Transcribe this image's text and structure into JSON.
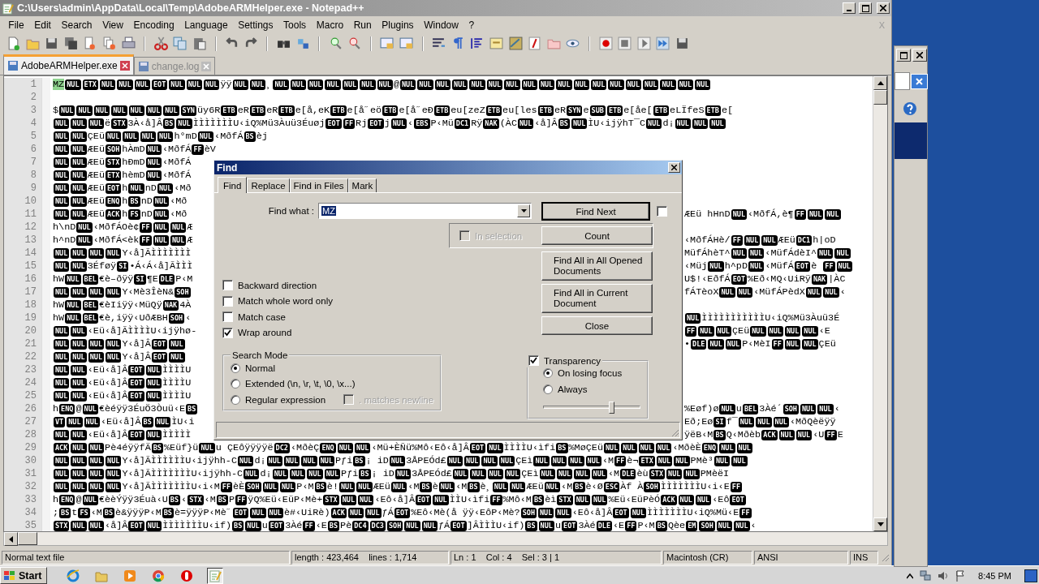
{
  "window": {
    "title": "C:\\Users\\admin\\AppData\\Local\\Temp\\AdobeARMHelper.exe - Notepad++"
  },
  "menu": [
    "File",
    "Edit",
    "Search",
    "View",
    "Encoding",
    "Language",
    "Settings",
    "Tools",
    "Macro",
    "Run",
    "Plugins",
    "Window",
    "?"
  ],
  "close_doc": "X",
  "tabs": [
    {
      "label": "AdobeARMHelper.exe",
      "selected": true
    },
    {
      "label": "change.log",
      "selected": false
    }
  ],
  "editor": {
    "lines": [
      {
        "n": "1",
        "parts": [
          {
            "text": "MZ",
            "selected": true
          },
          {
            "c": "NUL"
          },
          {
            "c": "ETX"
          },
          {
            "c": "NUL"
          },
          {
            "c": "NUL"
          },
          {
            "c": "NUL"
          },
          {
            "c": "EOT"
          },
          {
            "c": "NUL"
          },
          {
            "c": "NUL"
          },
          {
            "c": "NUL"
          },
          "ÿÿ",
          {
            "c": "NUL"
          },
          {
            "c": "NUL"
          },
          "¸",
          {
            "c": "NUL"
          },
          {
            "c": "NUL"
          },
          {
            "c": "NUL"
          },
          {
            "c": "NUL"
          },
          {
            "c": "NUL"
          },
          {
            "c": "NUL"
          },
          {
            "c": "NUL"
          },
          "@",
          {
            "c": "NUL"
          },
          {
            "c": "NUL"
          },
          {
            "c": "NUL"
          },
          {
            "c": "NUL"
          },
          {
            "c": "NUL"
          },
          {
            "c": "NUL"
          },
          {
            "c": "NUL"
          },
          {
            "c": "NUL"
          },
          {
            "c": "NUL"
          },
          {
            "c": "NUL"
          },
          {
            "c": "NUL"
          },
          {
            "c": "NUL"
          },
          {
            "c": "NUL"
          },
          {
            "c": "NUL"
          },
          {
            "c": "NUL"
          },
          {
            "c": "NUL"
          },
          {
            "c": "NUL"
          },
          {
            "c": "NUL"
          }
        ]
      },
      {
        "n": "2"
      },
      {
        "n": "3",
        "parts": [
          "$",
          {
            "c": "NUL"
          },
          {
            "c": "NUL"
          },
          {
            "c": "NUL"
          },
          {
            "c": "NUL"
          },
          {
            "c": "NUL"
          },
          {
            "c": "NUL"
          },
          {
            "c": "NUL"
          },
          {
            "c": "SYN"
          },
          "üy6R",
          {
            "c": "ETB"
          },
          "eR",
          {
            "c": "ETB"
          },
          "eR",
          {
            "c": "ETB"
          },
          "e[å,eK",
          {
            "c": "ETB"
          },
          "e[å˝eö",
          {
            "c": "ETB"
          },
          "e[å˝eĐ",
          {
            "c": "ETB"
          },
          "eu[zeZ",
          {
            "c": "ETB"
          },
          "eu[les",
          {
            "c": "ETB"
          },
          "eR",
          {
            "c": "SYN"
          },
          "e",
          {
            "c": "SUB"
          },
          {
            "c": "ETB"
          },
          "e[åe[",
          {
            "c": "ETB"
          },
          "eLÏfeS",
          {
            "c": "ETB"
          },
          "e["
        ]
      },
      {
        "n": "4",
        "parts": [
          {
            "c": "NUL"
          },
          {
            "c": "NUL"
          },
          {
            "c": "NUL"
          },
          "ë",
          {
            "c": "STX"
          },
          "3À‹å]Â",
          {
            "c": "BS"
          },
          {
            "c": "NUL"
          },
          "ÌÌÌÌÌÌÌU‹iQ%Mü3Àuü3Éuøj",
          {
            "c": "EOT"
          },
          {
            "c": "FF"
          },
          "Rj",
          {
            "c": "EOT"
          },
          "j",
          {
            "c": "NUL"
          },
          "‹",
          {
            "c": "EBS"
          },
          "P‹Mü",
          {
            "c": "DC1"
          },
          "Rÿ",
          {
            "c": "NAK"
          },
          "(ÀC",
          {
            "c": "NUL"
          },
          "‹å]Â",
          {
            "c": "BS"
          },
          {
            "c": "NUL"
          },
          "ÌU‹ijÿhT¯C",
          {
            "c": "NUL"
          },
          "d¡",
          {
            "c": "NUL"
          },
          {
            "c": "NUL"
          },
          {
            "c": "NUL"
          }
        ]
      },
      {
        "n": "5",
        "parts": [
          {
            "c": "NUL"
          },
          {
            "c": "NUL"
          },
          "ÇEü",
          {
            "c": "NUL"
          },
          {
            "c": "NUL"
          },
          {
            "c": "NUL"
          },
          {
            "c": "NUL"
          },
          "h°mD",
          {
            "c": "NUL"
          },
          "‹MðfÁ",
          {
            "c": "BS"
          },
          "èj"
        ]
      },
      {
        "n": "6",
        "parts": [
          {
            "c": "NUL"
          },
          {
            "c": "NUL"
          },
          "ÆEü",
          {
            "c": "SOH"
          },
          "hÀmD",
          {
            "c": "NUL"
          },
          "‹MðfÁ",
          {
            "c": "FF"
          },
          "èV"
        ]
      },
      {
        "n": "7",
        "parts": [
          {
            "c": "NUL"
          },
          {
            "c": "NUL"
          },
          "ÆEü",
          {
            "c": "STX"
          },
          "hÐmD",
          {
            "c": "NUL"
          },
          "‹MðfÁ"
        ]
      },
      {
        "n": "8",
        "parts": [
          {
            "c": "NUL"
          },
          {
            "c": "NUL"
          },
          "ÆEü",
          {
            "c": "ETX"
          },
          "hèmD",
          {
            "c": "NUL"
          },
          "‹MðfÁ"
        ]
      },
      {
        "n": "9",
        "parts": [
          {
            "c": "NUL"
          },
          {
            "c": "NUL"
          },
          "ÆEü",
          {
            "c": "EOT"
          },
          "h",
          {
            "c": "NUL"
          },
          "nD",
          {
            "c": "NUL"
          },
          "‹Mð"
        ]
      },
      {
        "n": "10",
        "parts": [
          {
            "c": "NUL"
          },
          {
            "c": "NUL"
          },
          "ÆEü",
          {
            "c": "ENQ"
          },
          "h",
          {
            "c": "BS"
          },
          "nD",
          {
            "c": "NUL"
          },
          "‹Mð"
        ]
      },
      {
        "n": "11",
        "parts": [
          {
            "c": "NUL"
          },
          {
            "c": "NUL"
          },
          "ÆEü",
          {
            "c": "ACK"
          },
          "h",
          {
            "c": "FS"
          },
          "nD",
          {
            "c": "NUL"
          },
          "‹Mð"
        ],
        "tail": [
          "ÆEü hHnD",
          {
            "c": "NUL"
          },
          "‹MðfÁ,è¶",
          {
            "c": "FF"
          },
          {
            "c": "NUL"
          },
          {
            "c": "NUL"
          }
        ]
      },
      {
        "n": "12",
        "parts": [
          "h\\nD",
          {
            "c": "NUL"
          },
          "‹MðfÁOè¢",
          {
            "c": "FF"
          },
          {
            "c": "NUL"
          },
          {
            "c": "NUL"
          },
          "Æ"
        ]
      },
      {
        "n": "13",
        "parts": [
          "h^nD",
          {
            "c": "NUL"
          },
          "‹MðfÁ<èk",
          {
            "c": "FF"
          },
          {
            "c": "NUL"
          },
          {
            "c": "NUL"
          },
          "Æ"
        ],
        "tail": [
          "‹MðfÁHè/",
          {
            "c": "FF"
          },
          {
            "c": "NUL"
          },
          {
            "c": "NUL"
          },
          "ÆEü",
          {
            "c": "DC1"
          },
          "h|oD"
        ]
      },
      {
        "n": "14",
        "parts": [
          {
            "c": "NUL"
          },
          {
            "c": "NUL"
          },
          {
            "c": "NUL"
          },
          {
            "c": "NUL"
          },
          "Y‹å]ÃÌÌÌÌÌÌÌ"
        ],
        "tail": [
          "MüfÁhèT^",
          {
            "c": "NUL"
          },
          {
            "c": "NUL"
          },
          "‹MüfÁdèI^",
          {
            "c": "NUL"
          },
          {
            "c": "NUL"
          }
        ]
      },
      {
        "n": "15",
        "parts": [
          {
            "c": "NUL"
          },
          {
            "c": "NUL"
          },
          "3Éføÿ",
          {
            "c": "SI"
          },
          "•Á‹Á‹å]ÃÌÌÌ"
        ],
        "tail": [
          "‹Müj",
          {
            "c": "NUL"
          },
          "h^pD",
          {
            "c": "NUL"
          },
          "‹MüfÁ",
          {
            "c": "EOT"
          },
          "è ",
          {
            "c": "FF"
          },
          {
            "c": "NUL"
          }
        ]
      },
      {
        "n": "16",
        "parts": [
          "hW",
          {
            "c": "NUL"
          },
          {
            "c": "BEL"
          },
          "€è–ðÿÿ",
          {
            "c": "SI"
          },
          "¶E",
          {
            "c": "DLE"
          },
          "P‹M"
        ],
        "tail": [
          "U$!‹EðfÁ",
          {
            "c": "EOT"
          },
          "%Eð‹MQ‹UiRÿ",
          {
            "c": "NAK"
          },
          "|ÀC"
        ]
      },
      {
        "n": "17",
        "parts": [
          {
            "c": "NUL"
          },
          {
            "c": "NUL"
          },
          {
            "c": "NUL"
          },
          {
            "c": "NUL"
          },
          "Y‹Mè3ÎèN&",
          {
            "c": "SOH"
          }
        ],
        "tail": [
          "fÁTèoX",
          {
            "c": "NUL"
          },
          {
            "c": "NUL"
          },
          "‹MüfÁPèdX",
          {
            "c": "NUL"
          },
          {
            "c": "NUL"
          },
          "‹"
        ]
      },
      {
        "n": "18",
        "parts": [
          "hW",
          {
            "c": "NUL"
          },
          {
            "c": "BEL"
          },
          "€èIiÿÿ‹MüQÿ",
          {
            "c": "NAK"
          },
          "4À"
        ]
      },
      {
        "n": "19",
        "parts": [
          "hW",
          {
            "c": "NUL"
          },
          {
            "c": "BEL"
          },
          "€è,iÿÿ‹UðÆBH",
          {
            "c": "SOH"
          },
          "‹"
        ],
        "tail": [
          {
            "c": "NUL"
          },
          "ÌÌÌÌÌÌÌÌÌÌÌU‹iQ%Mü3Àuü3É"
        ]
      },
      {
        "n": "20",
        "parts": [
          {
            "c": "NUL"
          },
          {
            "c": "NUL"
          },
          "‹Eü‹å]ÃÌÌÌÌU‹ijÿhø-"
        ],
        "tail": [
          {
            "c": "FF"
          },
          {
            "c": "NUL"
          },
          {
            "c": "NUL"
          },
          "ÇEü",
          {
            "c": "NUL"
          },
          {
            "c": "NUL"
          },
          {
            "c": "NUL"
          },
          {
            "c": "NUL"
          },
          "‹E"
        ]
      },
      {
        "n": "21",
        "parts": [
          {
            "c": "NUL"
          },
          {
            "c": "NUL"
          },
          {
            "c": "NUL"
          },
          {
            "c": "NUL"
          },
          "Y‹å]Â",
          {
            "c": "EOT"
          },
          {
            "c": "NUL"
          }
        ],
        "tail": [
          "•",
          {
            "c": "DLE"
          },
          {
            "c": "NUL"
          },
          {
            "c": "NUL"
          },
          "P‹MèI",
          {
            "c": "FF"
          },
          {
            "c": "NUL"
          },
          {
            "c": "NUL"
          },
          "ÇEü"
        ]
      },
      {
        "n": "22",
        "parts": [
          {
            "c": "NUL"
          },
          {
            "c": "NUL"
          },
          {
            "c": "NUL"
          },
          {
            "c": "NUL"
          },
          "Y‹å]Â",
          {
            "c": "EOT"
          },
          {
            "c": "NUL"
          }
        ]
      },
      {
        "n": "23",
        "parts": [
          {
            "c": "NUL"
          },
          {
            "c": "NUL"
          },
          "‹Eü‹å]Â",
          {
            "c": "EOT"
          },
          {
            "c": "NUL"
          },
          "ÌÌÌÌU"
        ]
      },
      {
        "n": "24",
        "parts": [
          {
            "c": "NUL"
          },
          {
            "c": "NUL"
          },
          "‹Eü‹å]Â",
          {
            "c": "EOT"
          },
          {
            "c": "NUL"
          },
          "ÌÌÌÌU"
        ]
      },
      {
        "n": "25",
        "parts": [
          {
            "c": "NUL"
          },
          {
            "c": "NUL"
          },
          "‹Eü‹å]Â",
          {
            "c": "EOT"
          },
          {
            "c": "NUL"
          },
          "ÌÌÌÌU"
        ]
      },
      {
        "n": "26",
        "parts": [
          "h",
          {
            "c": "ENQ"
          },
          "@",
          {
            "c": "NUL"
          },
          "€èéÿÿ3ÉuÖ3Òuü‹E",
          {
            "c": "BS"
          }
        ],
        "tail": [
          "%Eøf)ø",
          {
            "c": "NUL"
          },
          "u",
          {
            "c": "BEL"
          },
          "3Àé´",
          {
            "c": "SOH"
          },
          {
            "c": "NUL"
          },
          {
            "c": "NUL"
          },
          "‹"
        ]
      },
      {
        "n": "27",
        "parts": [
          {
            "c": "VT"
          },
          {
            "c": "NUL"
          },
          {
            "c": "NUL"
          },
          "‹Eü‹å]Â",
          {
            "c": "BS"
          },
          {
            "c": "NUL"
          },
          "ÌU‹i"
        ],
        "tail": [
          "Eð;Eø",
          {
            "c": "SI"
          },
          "f¯",
          {
            "c": "NUL"
          },
          {
            "c": "NUL"
          },
          {
            "c": "NUL"
          },
          "‹MðQèëÿÿ"
        ]
      },
      {
        "n": "28",
        "parts": [
          {
            "c": "NUL"
          },
          {
            "c": "NUL"
          },
          "‹Eü‹å]Â",
          {
            "c": "EOT"
          },
          {
            "c": "NUL"
          },
          "ÌÌÌÌÌ"
        ],
        "tail": [
          "ÿëB‹M",
          {
            "c": "BS"
          },
          "Q‹Mðèb",
          {
            "c": "ACK"
          },
          {
            "c": "NUL"
          },
          {
            "c": "NUL"
          },
          "‹U",
          {
            "c": "FF"
          },
          "E"
        ]
      },
      {
        "n": "29",
        "parts": [
          {
            "c": "ACK"
          },
          {
            "c": "NUL"
          },
          {
            "c": "NUL"
          },
          "Pè4éÿÿfÄ",
          {
            "c": "BS"
          },
          "%Eüf}ü",
          {
            "c": "NUL"
          },
          "u ÇEôÿÿÿÿë",
          {
            "c": "DC2"
          },
          "‹MðèÇ",
          {
            "c": "ENQ"
          },
          {
            "c": "NUL"
          },
          {
            "c": "NUL"
          },
          "‹Mü+ÈÑü%Mô‹Eô‹å]Â",
          {
            "c": "EOT"
          },
          {
            "c": "NUL"
          },
          "ÌÌÌÌU‹ìfi",
          {
            "c": "BS"
          },
          "%MøÇEü",
          {
            "c": "NUL"
          },
          {
            "c": "NUL"
          },
          {
            "c": "NUL"
          },
          {
            "c": "NUL"
          },
          "‹MðèÈ",
          {
            "c": "ENQ"
          },
          {
            "c": "NUL"
          },
          {
            "c": "NUL"
          }
        ]
      },
      {
        "n": "30",
        "parts": [
          {
            "c": "NUL"
          },
          {
            "c": "NUL"
          },
          {
            "c": "NUL"
          },
          {
            "c": "NUL"
          },
          "Y‹å]ÃÌÌÌÌÌÌU‹ijÿhh-C",
          {
            "c": "NUL"
          },
          "d¡",
          {
            "c": "NUL"
          },
          {
            "c": "NUL"
          },
          {
            "c": "NUL"
          },
          {
            "c": "NUL"
          },
          "Pƒi",
          {
            "c": "BS"
          },
          "¡ iD",
          {
            "c": "NUL"
          },
          "3ÅPEÓd£",
          {
            "c": "NUL"
          },
          {
            "c": "NUL"
          },
          {
            "c": "NUL"
          },
          {
            "c": "NUL"
          },
          "ÇEì",
          {
            "c": "NUL"
          },
          {
            "c": "NUL"
          },
          {
            "c": "NUL"
          },
          {
            "c": "NUL"
          },
          "‹M",
          {
            "c": "FF"
          },
          "è¬",
          {
            "c": "ETX"
          },
          {
            "c": "NUL"
          },
          {
            "c": "NUL"
          },
          "PMè³",
          {
            "c": "NUL"
          },
          {
            "c": "NUL"
          }
        ]
      },
      {
        "n": "31",
        "parts": [
          {
            "c": "NUL"
          },
          {
            "c": "NUL"
          },
          {
            "c": "NUL"
          },
          {
            "c": "NUL"
          },
          "Y‹å]ÃÌÌÌÌÌÌÌU‹ijÿhh-C",
          {
            "c": "NUL"
          },
          "d¡",
          {
            "c": "NUL"
          },
          {
            "c": "NUL"
          },
          {
            "c": "NUL"
          },
          {
            "c": "NUL"
          },
          "Pƒi",
          {
            "c": "BS"
          },
          "¡ iD",
          {
            "c": "NUL"
          },
          "3ÅPEÓd£",
          {
            "c": "NUL"
          },
          {
            "c": "NUL"
          },
          {
            "c": "NUL"
          },
          {
            "c": "NUL"
          },
          "ÇEì",
          {
            "c": "NUL"
          },
          {
            "c": "NUL"
          },
          {
            "c": "NUL"
          },
          {
            "c": "NUL"
          },
          "‹M",
          {
            "c": "DLE"
          },
          "èù",
          {
            "c": "STX"
          },
          {
            "c": "NUL"
          },
          {
            "c": "NUL"
          },
          "PMèëI"
        ]
      },
      {
        "n": "32",
        "parts": [
          {
            "c": "NUL"
          },
          {
            "c": "NUL"
          },
          {
            "c": "NUL"
          },
          {
            "c": "NUL"
          },
          "Y‹å]ÃÌÌÌÌÌÌÌU‹i‹M",
          {
            "c": "FF"
          },
          "èÈ",
          {
            "c": "SOH"
          },
          {
            "c": "NUL"
          },
          {
            "c": "NUL"
          },
          "P‹M",
          {
            "c": "BS"
          },
          "è!",
          {
            "c": "NUL"
          },
          {
            "c": "NUL"
          },
          "ÆEü",
          {
            "c": "NUL"
          },
          "‹M",
          {
            "c": "BS"
          },
          "è",
          {
            "c": "NUL"
          },
          "‹M",
          {
            "c": "BS"
          },
          "è¸",
          {
            "c": "NUL"
          },
          {
            "c": "NUL"
          },
          "ÆEü",
          {
            "c": "NUL"
          },
          "‹M",
          {
            "c": "BS"
          },
          "è‹Ø",
          {
            "c": "ESC"
          },
          "Àf À",
          {
            "c": "SOH"
          },
          "ÌÌÌÌÌÌÌU‹i‹E",
          {
            "c": "FF"
          }
        ]
      },
      {
        "n": "33",
        "parts": [
          "h",
          {
            "c": "ENQ"
          },
          "@",
          {
            "c": "NUL"
          },
          "€èèÝÿÿ3Éuà‹U",
          {
            "c": "BS"
          },
          "‹",
          {
            "c": "STX"
          },
          "‹M",
          {
            "c": "BS"
          },
          "P",
          {
            "c": "FF"
          },
          "ÿQ%Eü‹EüP‹Mè+",
          {
            "c": "STX"
          },
          {
            "c": "NUL"
          },
          {
            "c": "NUL"
          },
          "‹Eô‹å]Â",
          {
            "c": "EOT"
          },
          {
            "c": "NUL"
          },
          "ÌÌU‹ìfi",
          {
            "c": "FF"
          },
          "%Mô‹M",
          {
            "c": "BS"
          },
          "èì",
          {
            "c": "STX"
          },
          {
            "c": "NUL"
          },
          {
            "c": "NUL"
          },
          "%Eü‹EüPèÓ",
          {
            "c": "ACK"
          },
          {
            "c": "NUL"
          },
          {
            "c": "NUL"
          },
          "‹Eô",
          {
            "c": "EOT"
          }
        ]
      },
      {
        "n": "34",
        "parts": [
          ";",
          {
            "c": "BS"
          },
          "t",
          {
            "c": "FS"
          },
          "‹M",
          {
            "c": "BS"
          },
          "è&ÿÿÿP‹M",
          {
            "c": "BS"
          },
          "è=ÿÿÿP‹Mè˝",
          {
            "c": "EOT"
          },
          {
            "c": "NUL"
          },
          {
            "c": "NUL"
          },
          "è#‹UiRè)",
          {
            "c": "ACK"
          },
          {
            "c": "NUL"
          },
          {
            "c": "NUL"
          },
          "ƒÁ",
          {
            "c": "EOT"
          },
          "%Eô‹Mè(å ÿÿ‹EôP‹Mè?",
          {
            "c": "SOH"
          },
          {
            "c": "NUL"
          },
          {
            "c": "NUL"
          },
          "‹Eô‹å]Â",
          {
            "c": "EOT"
          },
          {
            "c": "NUL"
          },
          "ÌÌÌÌÌÌÌU‹iQ%Mü‹E",
          {
            "c": "FF"
          }
        ]
      },
      {
        "n": "35",
        "parts": [
          {
            "c": "STX"
          },
          {
            "c": "NUL"
          },
          {
            "c": "NUL"
          },
          "‹å]Â",
          {
            "c": "EOT"
          },
          {
            "c": "NUL"
          },
          "ÌÌÌÌÌÌÌU‹if)",
          {
            "c": "BS"
          },
          {
            "c": "NUL"
          },
          "u",
          {
            "c": "EOT"
          },
          "3Àé",
          {
            "c": "FF"
          },
          "‹E",
          {
            "c": "BS"
          },
          "Pè",
          {
            "c": "DC4"
          },
          {
            "c": "DC3"
          },
          {
            "c": "SOH"
          },
          {
            "c": "NUL"
          },
          {
            "c": "NUL"
          },
          "ƒÁ",
          {
            "c": "EOT"
          },
          "]ÂÌÌÌU‹if)",
          {
            "c": "BS"
          },
          {
            "c": "NUL"
          },
          "u",
          {
            "c": "EOT"
          },
          "3Àé",
          {
            "c": "DLE"
          },
          "‹E",
          {
            "c": "FF"
          },
          "P‹M",
          {
            "c": "BS"
          },
          "Qèe",
          {
            "c": "EM"
          },
          {
            "c": "SOH"
          },
          {
            "c": "NUL"
          },
          {
            "c": "NUL"
          },
          "‹"
        ]
      }
    ]
  },
  "status_bar": [
    "Normal text file",
    "length : 423,464    lines : 1,714",
    "Ln : 1    Col : 4    Sel : 3 | 1",
    "Macintosh (CR)",
    "ANSI",
    "INS"
  ],
  "find_dialog": {
    "title": "Find",
    "tabs": [
      {
        "label": "Find",
        "selected": true
      },
      {
        "label": "Replace",
        "selected": false
      },
      {
        "label": "Find in Files",
        "selected": false
      },
      {
        "label": "Mark",
        "selected": false
      }
    ],
    "find_what": {
      "label": "Find what :",
      "value": "MZ",
      "value_selected": true
    },
    "extra_checkbox": {
      "checked": false
    },
    "in_selection": {
      "label": "In selection",
      "checked": false,
      "disabled": true
    },
    "buttons": [
      {
        "label": "Find Next",
        "kind": "default"
      },
      {
        "label": "Count",
        "kind": "selection"
      },
      {
        "label": "Find All in All Opened Documents",
        "kind": "tall"
      },
      {
        "label": "Find All in Current Document",
        "kind": "tall"
      },
      {
        "label": "Close",
        "kind": "normal"
      }
    ],
    "options": [
      {
        "label": "Backward direction",
        "checked": false
      },
      {
        "label": "Match whole word only",
        "checked": false
      },
      {
        "label": "Match case",
        "checked": false
      },
      {
        "label": "Wrap around",
        "checked": true
      }
    ],
    "search_mode": {
      "title": "Search Mode",
      "modes": [
        {
          "label": "Normal",
          "selected": true
        },
        {
          "label": "Extended (\\n, \\r, \\t, \\0, \\x...)",
          "selected": false
        },
        {
          "label": "Regular expression",
          "selected": false
        }
      ],
      "matches_newline": {
        "label": ". matches newline",
        "checked": false,
        "disabled": true
      }
    },
    "transparency": {
      "label": "Transparency",
      "checked": true,
      "options": [
        {
          "label": "On losing focus",
          "selected": true
        },
        {
          "label": "Always",
          "selected": false
        }
      ],
      "level": 0.7
    }
  },
  "taskbar": {
    "start": "Start",
    "apps": [
      {
        "selected": false
      },
      {
        "selected": false
      },
      {
        "selected": false
      },
      {
        "selected": false
      },
      {
        "selected": false
      },
      {
        "selected": true
      }
    ],
    "clock": "8:45 PM"
  }
}
